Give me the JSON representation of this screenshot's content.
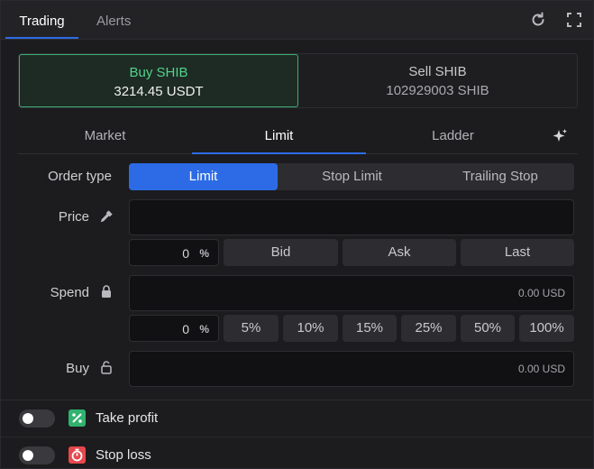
{
  "header": {
    "tabs": [
      {
        "label": "Trading",
        "active": true
      },
      {
        "label": "Alerts",
        "active": false
      }
    ],
    "icons": [
      "refresh-icon",
      "expand-icon"
    ]
  },
  "side": {
    "buy": {
      "title": "Buy SHIB",
      "balance": "3214.45 USDT"
    },
    "sell": {
      "title": "Sell SHIB",
      "balance": "102929003 SHIB"
    }
  },
  "order_tabs": [
    {
      "label": "Market",
      "active": false
    },
    {
      "label": "Limit",
      "active": true
    },
    {
      "label": "Ladder",
      "active": false
    }
  ],
  "order_type": {
    "label": "Order type",
    "options": [
      "Limit",
      "Stop Limit",
      "Trailing Stop"
    ],
    "selected": "Limit"
  },
  "price": {
    "label": "Price",
    "value": "",
    "percent_value": "0",
    "percent_symbol": "%",
    "quick": [
      "Bid",
      "Ask",
      "Last"
    ]
  },
  "spend": {
    "label": "Spend",
    "value": "0.00 USD",
    "percent_value": "0",
    "percent_symbol": "%",
    "quick": [
      "5%",
      "10%",
      "15%",
      "25%",
      "50%",
      "100%"
    ]
  },
  "buy_amount": {
    "label": "Buy",
    "value": "0.00 USD"
  },
  "take_profit": {
    "label": "Take profit",
    "enabled": false
  },
  "stop_loss": {
    "label": "Stop loss",
    "enabled": false
  },
  "colors": {
    "accent": "#2d6be6",
    "buy": "#52d38b",
    "take_profit": "#2fb36e",
    "stop_loss": "#e5484d"
  }
}
